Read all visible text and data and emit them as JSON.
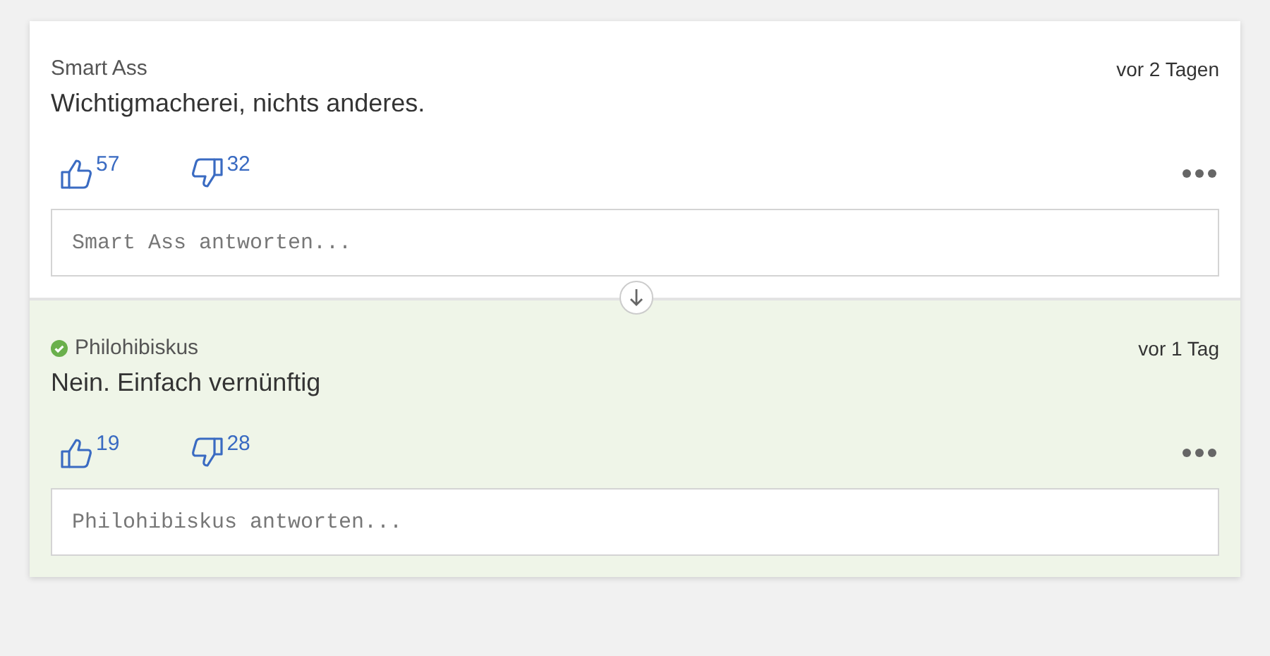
{
  "comments": [
    {
      "author": "Smart Ass",
      "verified": false,
      "highlighted": false,
      "time": "vor 2 Tagen",
      "text": "Wichtigmacherei, nichts anderes.",
      "likes": "57",
      "dislikes": "32",
      "reply": {
        "placeholder": "Smart Ass antworten..."
      }
    },
    {
      "author": "Philohibiskus",
      "verified": true,
      "highlighted": true,
      "time": "vor 1 Tag",
      "text": "Nein. Einfach vernünftig",
      "likes": "19",
      "dislikes": "28",
      "reply": {
        "placeholder": "Philohibiskus antworten..."
      }
    }
  ]
}
